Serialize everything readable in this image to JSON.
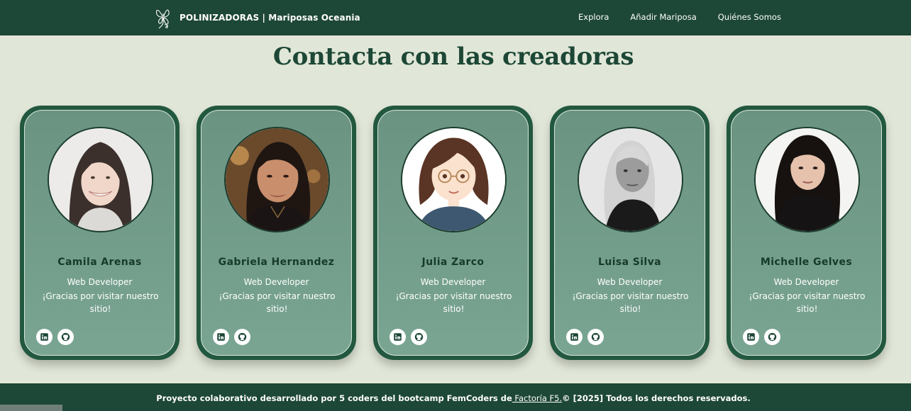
{
  "navbar": {
    "brand": "POLINIZADORAS | Mariposas Oceania",
    "logo_icon": "butterfly-icon",
    "links": [
      "Explora",
      "Añadir Mariposa",
      "Quiénes Somos"
    ]
  },
  "page": {
    "title": "Contacta con las creadoras"
  },
  "members": [
    {
      "name": "Camila Arenas",
      "role": "Web Developer",
      "message": "¡Gracias por visitar nuestro sitio!"
    },
    {
      "name": "Gabriela Hernandez",
      "role": "Web Developer",
      "message": "¡Gracias por visitar nuestro sitio!"
    },
    {
      "name": "Julia Zarco",
      "role": "Web Developer",
      "message": "¡Gracias por visitar nuestro sitio!"
    },
    {
      "name": "Luisa Silva",
      "role": "Web Developer",
      "message": "¡Gracias por visitar nuestro sitio!"
    },
    {
      "name": "Michelle Gelves",
      "role": "Web Developer",
      "message": "¡Gracias por visitar nuestro sitio!"
    }
  ],
  "social_icons": [
    "linkedin-icon",
    "github-icon"
  ],
  "footer": {
    "text_before": "Proyecto colaborativo desarrollado por 5 coders del bootcamp FemCoders de",
    "link": " Factoría F5.",
    "text_after": "© [2025] Todos los derechos reservados."
  },
  "colors": {
    "primary": "#1d4736",
    "background": "#e1e7d8",
    "card_outer": "#22583f",
    "card_inner": "#6b9381",
    "name_text": "#163a2a"
  }
}
